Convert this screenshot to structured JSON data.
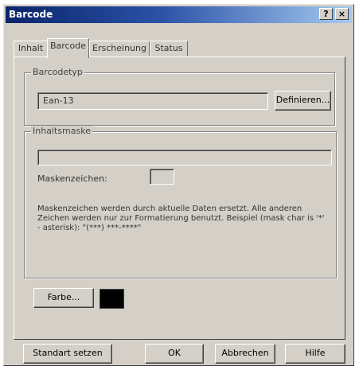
{
  "window": {
    "title": "Barcode",
    "help_glyph": "?",
    "close_glyph": "×"
  },
  "tabs": [
    {
      "label": "Inhalt"
    },
    {
      "label": "Barcode"
    },
    {
      "label": "Erscheinung"
    },
    {
      "label": "Status"
    }
  ],
  "barcodetyp": {
    "group_label": "Barcodetyp",
    "value": "Ean-13",
    "define_button": "Definieren..."
  },
  "inhaltsmaske": {
    "group_label": "Inhaltsmaske",
    "mask_value": "",
    "maskenzeichen_label": "Maskenzeichen:",
    "maskenzeichen_value": "",
    "description": "Maskenzeichen werden durch aktuelle Daten ersetzt. Alle anderen Zeichen werden nur zur Formatierung benutzt. Beispiel (mask char is '*' - asterisk): \"(***) ***-****\""
  },
  "farbe": {
    "button": "Farbe...",
    "color": "#000000"
  },
  "footer": {
    "standard": "Standart setzen",
    "ok": "OK",
    "cancel": "Abbrechen",
    "help": "Hilfe"
  }
}
